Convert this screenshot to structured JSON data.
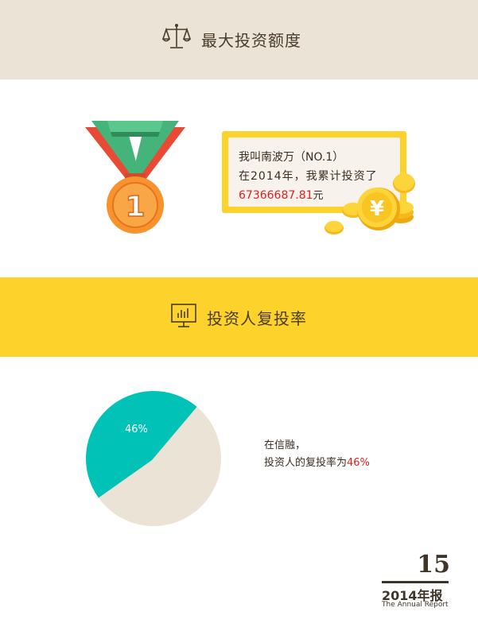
{
  "sections": {
    "max_investment": {
      "title": "最大投资额度",
      "icon": "scale-icon"
    },
    "repeat_rate": {
      "title": "投资人复投率",
      "icon": "monitor-chart-icon"
    }
  },
  "medal": {
    "rank": "1",
    "icon": "medal-icon"
  },
  "info_card": {
    "line1": "我叫南波万（NO.1）",
    "line2": "在2014年，我累计投资了",
    "amount": "67366687.81",
    "unit": "元"
  },
  "coins": {
    "symbol": "¥",
    "icon": "gold-coins-icon"
  },
  "rate": {
    "line1": "在信融，",
    "line2_prefix": "投资人的复投率为",
    "percent_text": "46%"
  },
  "footer": {
    "page_number": "15",
    "year_title": "2014年报",
    "subtitle": "The Annual Report"
  },
  "colors": {
    "top_band": "#ebe3d5",
    "yellow_band": "#fdd32b",
    "pie_teal": "#00c2b6",
    "pie_beige": "#ebe3d5",
    "highlight_red": "#e02020",
    "medal_orange": "#f7922c"
  },
  "chart_data": {
    "type": "pie",
    "slices": [
      {
        "label": "46%",
        "value": 46,
        "color": "#00c2b6"
      },
      {
        "label": "",
        "value": 54,
        "color": "#ebe3d5"
      }
    ]
  }
}
